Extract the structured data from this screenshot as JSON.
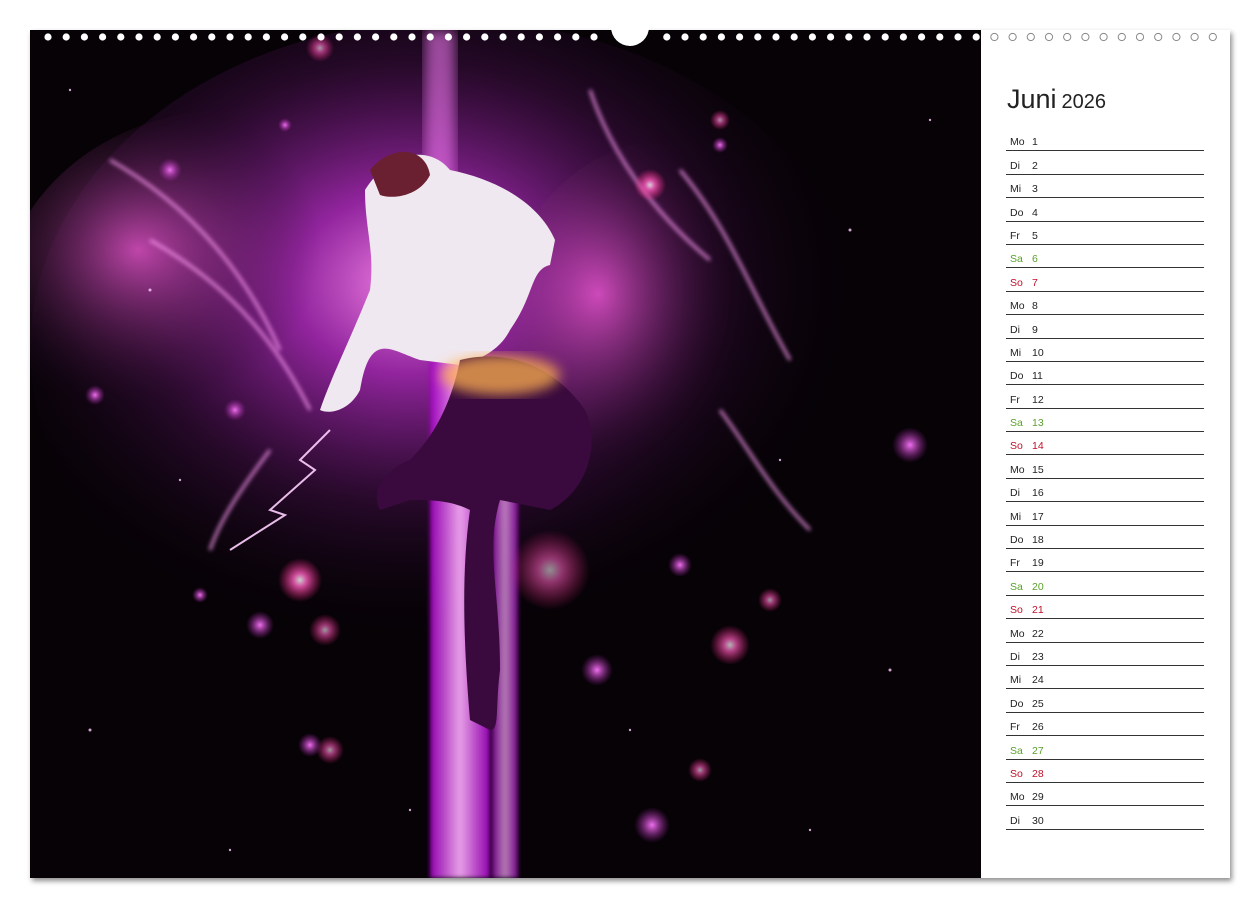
{
  "calendar": {
    "month": "Juni",
    "year": "2026",
    "days": [
      {
        "wd": "Mo",
        "d": "1",
        "type": "weekday"
      },
      {
        "wd": "Di",
        "d": "2",
        "type": "weekday"
      },
      {
        "wd": "Mi",
        "d": "3",
        "type": "weekday"
      },
      {
        "wd": "Do",
        "d": "4",
        "type": "weekday"
      },
      {
        "wd": "Fr",
        "d": "5",
        "type": "weekday"
      },
      {
        "wd": "Sa",
        "d": "6",
        "type": "sat"
      },
      {
        "wd": "So",
        "d": "7",
        "type": "sun"
      },
      {
        "wd": "Mo",
        "d": "8",
        "type": "weekday"
      },
      {
        "wd": "Di",
        "d": "9",
        "type": "weekday"
      },
      {
        "wd": "Mi",
        "d": "10",
        "type": "weekday"
      },
      {
        "wd": "Do",
        "d": "11",
        "type": "weekday"
      },
      {
        "wd": "Fr",
        "d": "12",
        "type": "weekday"
      },
      {
        "wd": "Sa",
        "d": "13",
        "type": "sat"
      },
      {
        "wd": "So",
        "d": "14",
        "type": "sun"
      },
      {
        "wd": "Mo",
        "d": "15",
        "type": "weekday"
      },
      {
        "wd": "Di",
        "d": "16",
        "type": "weekday"
      },
      {
        "wd": "Mi",
        "d": "17",
        "type": "weekday"
      },
      {
        "wd": "Do",
        "d": "18",
        "type": "weekday"
      },
      {
        "wd": "Fr",
        "d": "19",
        "type": "weekday"
      },
      {
        "wd": "Sa",
        "d": "20",
        "type": "sat"
      },
      {
        "wd": "So",
        "d": "21",
        "type": "sun"
      },
      {
        "wd": "Mo",
        "d": "22",
        "type": "weekday"
      },
      {
        "wd": "Di",
        "d": "23",
        "type": "weekday"
      },
      {
        "wd": "Mi",
        "d": "24",
        "type": "weekday"
      },
      {
        "wd": "Do",
        "d": "25",
        "type": "weekday"
      },
      {
        "wd": "Fr",
        "d": "26",
        "type": "weekday"
      },
      {
        "wd": "Sa",
        "d": "27",
        "type": "sat"
      },
      {
        "wd": "So",
        "d": "28",
        "type": "sun"
      },
      {
        "wd": "Mo",
        "d": "29",
        "type": "weekday"
      },
      {
        "wd": "Di",
        "d": "30",
        "type": "weekday"
      }
    ]
  },
  "colors": {
    "saturday": "#5aa12a",
    "sunday": "#c0102a",
    "glow": "#e040ff"
  }
}
